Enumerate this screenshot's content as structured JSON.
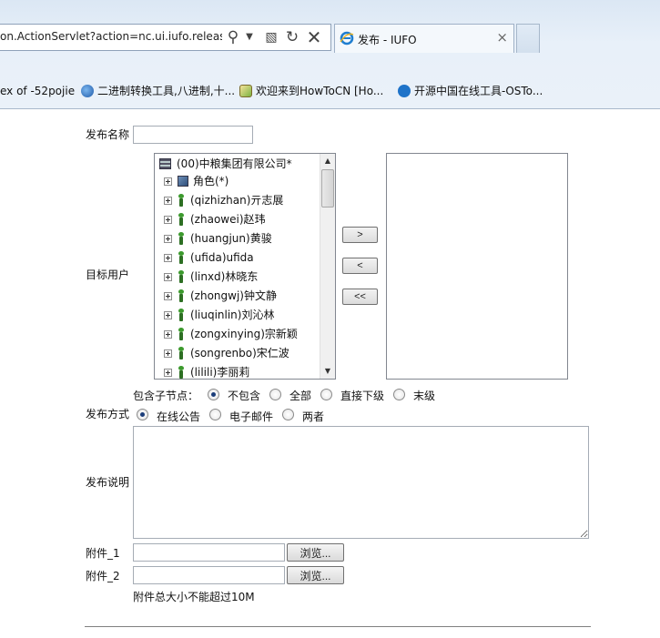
{
  "browser": {
    "url_text": "on.ActionServlet?action=nc.ui.iufo.release.I",
    "tab_title": "发布 - IUFO",
    "tab_close": "×",
    "favorites": [
      {
        "label": "ex of -52pojie"
      },
      {
        "label": "二进制转换工具,八进制,十..."
      },
      {
        "label": "欢迎来到HowToCN [Ho..."
      },
      {
        "label": "开源中国在线工具-OSTo..."
      }
    ]
  },
  "form": {
    "publish_name_label": "发布名称",
    "publish_name_value": "",
    "target_users_label": "目标用户",
    "tree": {
      "root": "(00)中粮集团有限公司*",
      "items": [
        {
          "label": "角色(*)",
          "icon": "role-icon"
        },
        {
          "label": "(qizhizhan)亓志展",
          "icon": "user-icon"
        },
        {
          "label": "(zhaowei)赵玮",
          "icon": "user-icon"
        },
        {
          "label": "(huangjun)黄骏",
          "icon": "user-icon"
        },
        {
          "label": "(ufida)ufida",
          "icon": "user-icon"
        },
        {
          "label": "(linxd)林晓东",
          "icon": "user-icon"
        },
        {
          "label": "(zhongwj)钟文静",
          "icon": "user-icon"
        },
        {
          "label": "(liuqinlin)刘沁林",
          "icon": "user-icon"
        },
        {
          "label": "(zongxinying)宗新颖",
          "icon": "user-icon"
        },
        {
          "label": "(songrenbo)宋仁波",
          "icon": "user-icon"
        },
        {
          "label": "(lilili)李丽莉",
          "icon": "user-icon"
        }
      ]
    },
    "move_buttons": {
      "add": ">",
      "remove": "<",
      "remove_all": "<<"
    },
    "include_children": {
      "label": "包含子节点：",
      "options": [
        "不包含",
        "全部",
        "直接下级",
        "末级"
      ],
      "selected": "不包含"
    },
    "publish_method": {
      "label": "发布方式",
      "options": [
        "在线公告",
        "电子邮件",
        "两者"
      ],
      "selected": "在线公告"
    },
    "description_label": "发布说明",
    "description_value": "",
    "attachment_1_label": "附件_1",
    "attachment_2_label": "附件_2",
    "browse_label": "浏览...",
    "size_note": "附件总大小不能超过10M"
  }
}
